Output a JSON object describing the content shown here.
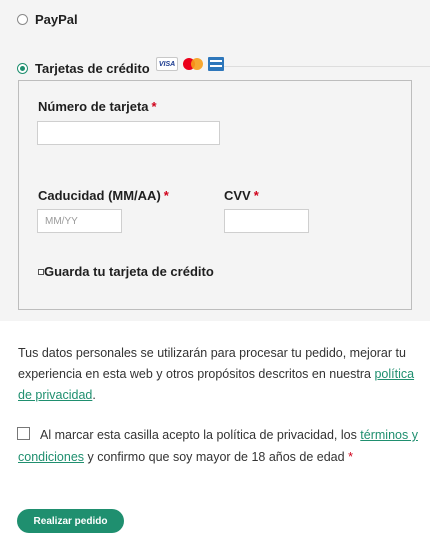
{
  "payment": {
    "paypal_label": "PayPal",
    "card_label": "Tarjetas de crédito",
    "card_logos": [
      "VISA",
      "mastercard",
      "amex"
    ]
  },
  "card_form": {
    "number_label": "Número de tarjeta",
    "number_value": "",
    "expiry_label": "Caducidad (MM/AA)",
    "expiry_placeholder": "MM/YY",
    "cvv_label": "CVV",
    "cvv_value": "",
    "required_mark": "*",
    "save_label": "Guarda tu tarjeta de crédito"
  },
  "notice": {
    "text_before": "Tus datos personales se utilizarán para procesar tu pedido, mejorar tu experiencia en esta web y otros propósitos descritos en nuestra ",
    "link": "política de privacidad",
    "text_after": "."
  },
  "terms": {
    "text_before": "Al marcar esta casilla acepto la política de privacidad, los ",
    "link": "términos y condiciones",
    "text_after": " y confirmo que soy mayor de 18 años de edad",
    "required_mark": "*"
  },
  "submit_label": "Realizar pedido",
  "colors": {
    "accent": "#1f8f6f",
    "required": "#d0021b",
    "panel": "#f4f4f4"
  }
}
